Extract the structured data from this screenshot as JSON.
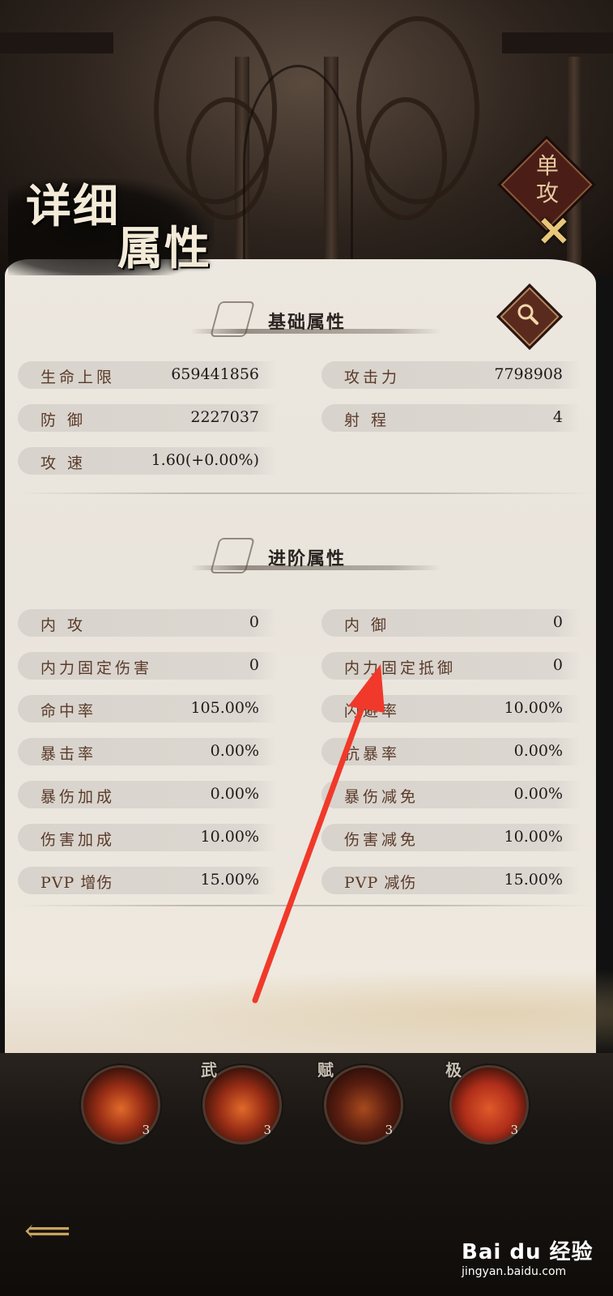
{
  "title": {
    "line1": "详细",
    "line2": "属性"
  },
  "stamp": {
    "line1": "单",
    "line2": "攻"
  },
  "close_icon": "close-icon",
  "basic": {
    "heading": "基础属性",
    "stats": [
      {
        "k": "生命上限",
        "v": "659441856"
      },
      {
        "k": "攻击力",
        "v": "7798908"
      },
      {
        "k": "防 御",
        "v": "2227037"
      },
      {
        "k": "射 程",
        "v": "4"
      },
      {
        "k": "攻 速",
        "v": "1.60(+0.00%)"
      }
    ]
  },
  "advanced": {
    "heading": "进阶属性",
    "stats": [
      {
        "k": "内 攻",
        "v": "0"
      },
      {
        "k": "内 御",
        "v": "0"
      },
      {
        "k": "内力固定伤害",
        "v": "0"
      },
      {
        "k": "内力固定抵御",
        "v": "0"
      },
      {
        "k": "命中率",
        "v": "105.00%"
      },
      {
        "k": "闪避率",
        "v": "10.00%"
      },
      {
        "k": "暴击率",
        "v": "0.00%"
      },
      {
        "k": "抗暴率",
        "v": "0.00%"
      },
      {
        "k": "暴伤加成",
        "v": "0.00%"
      },
      {
        "k": "暴伤减免",
        "v": "0.00%"
      },
      {
        "k": "伤害加成",
        "v": "10.00%"
      },
      {
        "k": "伤害减免",
        "v": "10.00%"
      },
      {
        "k": "PVP 增伤",
        "v": "15.00%"
      },
      {
        "k": "PVP 减伤",
        "v": "15.00%"
      }
    ]
  },
  "skills": {
    "tags": [
      "武",
      "赋",
      "极"
    ],
    "levels": [
      "3",
      "3",
      "3",
      "3"
    ]
  },
  "watermark": {
    "brand": "Bai du 经验",
    "url": "jingyan.baidu.com"
  },
  "colors": {
    "accent_red": "#f0392a",
    "label_brown": "#5a3a2a",
    "gold": "#e8c77a"
  }
}
